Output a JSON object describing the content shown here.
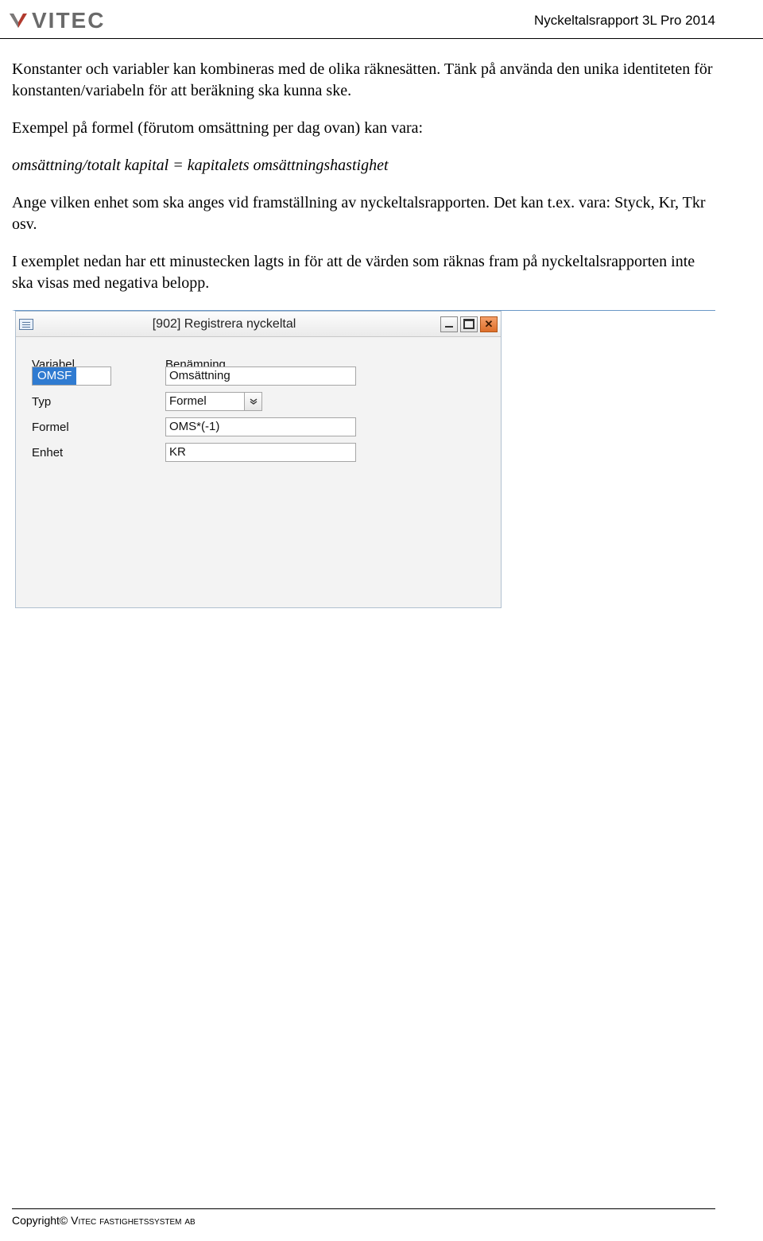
{
  "header": {
    "logo_text": "VITEC",
    "title": "Nyckeltalsrapport 3L Pro 2014"
  },
  "body": {
    "p1": "Konstanter och variabler kan kombineras med de olika räknesätten. Tänk på använda den unika identiteten för konstanten/variabeln för att beräkning ska kunna ske.",
    "p2": "Exempel på formel (förutom omsättning per dag ovan) kan vara:",
    "p3": "omsättning/totalt kapital = kapitalets omsättningshastighet",
    "p4": "Ange vilken enhet som ska anges vid framställning av nyckeltalsrapporten. Det kan t.ex. vara: Styck, Kr, Tkr osv.",
    "p5": "I exemplet nedan har ett minustecken lagts in för att de värden som räknas fram på nyckeltalsrapporten inte ska visas med negativa belopp."
  },
  "window": {
    "title": "[902]   Registrera nyckeltal",
    "labels": {
      "variabel": "Variabel",
      "benamning": "Benämning",
      "typ": "Typ",
      "formel": "Formel",
      "enhet": "Enhet"
    },
    "values": {
      "variabel": "OMSF",
      "benamning": "Omsättning",
      "typ": "Formel",
      "formel": "OMS*(-1)",
      "enhet": "KR"
    }
  },
  "footer": {
    "text_prefix": "Copyright© ",
    "text_company": "Vitec fastighetssystem ab"
  }
}
